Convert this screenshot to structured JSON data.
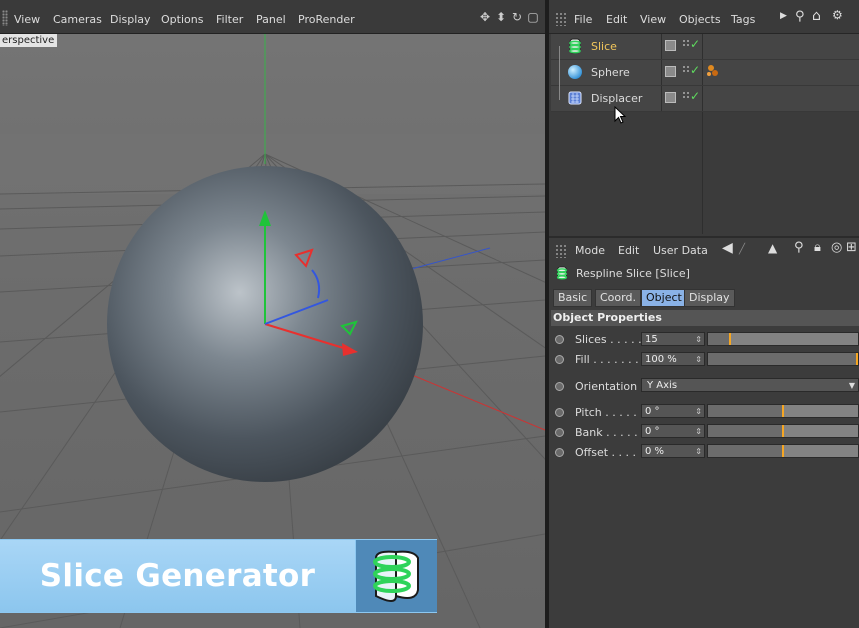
{
  "viewport": {
    "menu": [
      "View",
      "Cameras",
      "Display",
      "Options",
      "Filter",
      "Panel",
      "ProRender"
    ],
    "label": "erspective",
    "nav_icons": [
      "move-icon",
      "dolly-icon",
      "rotate-icon",
      "maximize-icon"
    ]
  },
  "banner": {
    "title": "Slice Generator",
    "bg_color": "#8dc8f1",
    "icon": "slice-icon"
  },
  "object_manager": {
    "menu": [
      "File",
      "Edit",
      "View",
      "Objects",
      "Tags"
    ],
    "objects": [
      {
        "name": "Slice",
        "icon": "slice-object-icon",
        "selected": true
      },
      {
        "name": "Sphere",
        "icon": "sphere-object-icon",
        "selected": false
      },
      {
        "name": "Displacer",
        "icon": "displacer-object-icon",
        "selected": false
      }
    ]
  },
  "attribute_manager": {
    "menu": [
      "Mode",
      "Edit",
      "User Data"
    ],
    "title": "Respline Slice [Slice]",
    "tabs": [
      "Basic",
      "Coord.",
      "Object",
      "Display"
    ],
    "active_tab": "Object",
    "section": "Object Properties",
    "properties": {
      "slices": {
        "label": "Slices . . . . .",
        "value": "15",
        "fraction": 0.14
      },
      "fill": {
        "label": "Fill . . . . . . .",
        "value": "100 %",
        "fraction": 1.0
      },
      "orientation": {
        "label": "Orientation",
        "value": "Y Axis"
      },
      "pitch": {
        "label": "Pitch . . . . .",
        "value": "0 °",
        "fraction": 0.5
      },
      "bank": {
        "label": "Bank . . . . .",
        "value": "0 °",
        "fraction": 0.5
      },
      "offset": {
        "label": "Offset . . . .",
        "value": "0 %",
        "fraction": 0.5
      }
    },
    "accent_color": "#f5a623"
  }
}
